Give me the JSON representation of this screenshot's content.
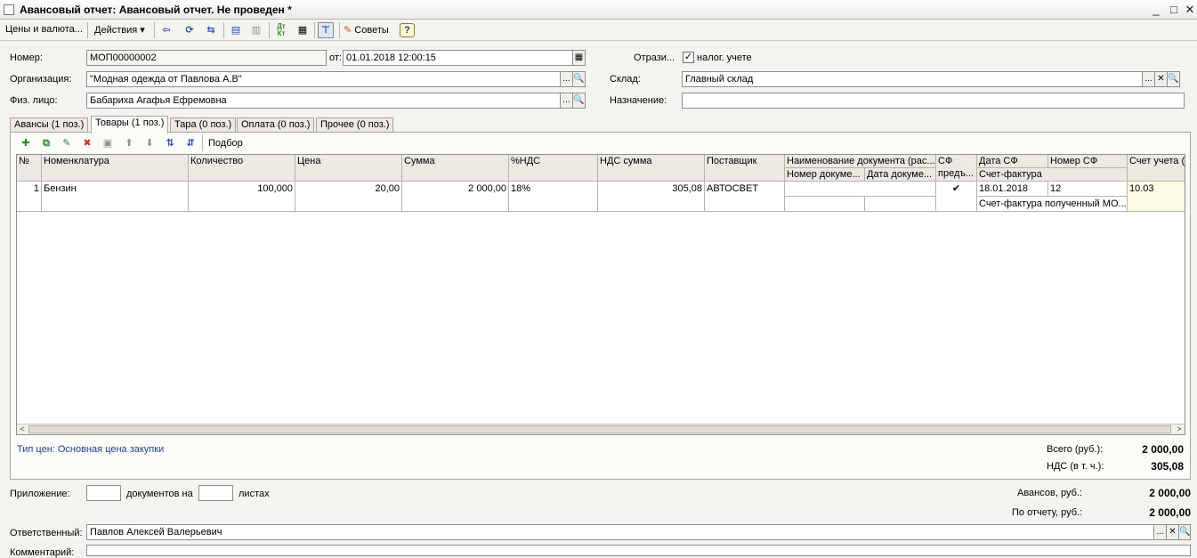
{
  "window": {
    "title": "Авансовый отчет: Авансовый отчет. Не проведен *",
    "buttons": {
      "minimize": "_",
      "maximize": "□",
      "close": "✕"
    }
  },
  "toolbar": {
    "prices_label": "Цены и валюта...",
    "actions_label": "Действия",
    "actions_arrow": "▾",
    "tips_label": "Советы",
    "help_label": "?"
  },
  "form": {
    "number_label": "Номер:",
    "number_value": "МОП00000002",
    "date_label": "от:",
    "date_value": "01.01.2018 12:00:15",
    "reflect_label": "Отрази...",
    "tax_accounting_label": "налог. учете",
    "tax_accounting_checked": "✓",
    "org_label": "Организация:",
    "org_value": "\"Модная одежда от Павлова А.В\"",
    "warehouse_label": "Склад:",
    "warehouse_value": "Главный склад",
    "person_label": "Физ. лицо:",
    "person_value": "Бабариха Агафья Ефремовна",
    "purpose_label": "Назначение:",
    "purpose_value": "",
    "select_btn": "...",
    "search_btn": "🔍",
    "clear_btn": "✕",
    "calendar_btn": "▦"
  },
  "tabs": [
    {
      "label": "Авансы (1 поз.)"
    },
    {
      "label": "Товары (1 поз.)"
    },
    {
      "label": "Тара (0 поз.)"
    },
    {
      "label": "Оплата (0 поз.)"
    },
    {
      "label": "Прочее (0 поз.)"
    }
  ],
  "grid_toolbar": {
    "selection_label": "Подбор"
  },
  "table": {
    "headers": {
      "num": "№",
      "nomenclature": "Номенклатура",
      "quantity": "Количество",
      "price": "Цена",
      "sum": "Сумма",
      "vat_rate": "%НДС",
      "vat_sum": "НДС сумма",
      "supplier": "Поставщик",
      "doc_name": "Наименование документа (рас...",
      "doc_number": "Номер докуме...",
      "doc_date": "Дата докуме...",
      "sf_top": "СФ",
      "sf_bottom": "предъ...",
      "sf_date": "Дата СФ",
      "sf_number": "Номер СФ",
      "sf_type": "Счет-фактура",
      "account": "Счет учета (Б"
    },
    "rows": [
      {
        "num": "1",
        "nomenclature": "Бензин",
        "quantity": "100,000",
        "price": "20,00",
        "sum": "2 000,00",
        "vat_rate": "18%",
        "vat_sum": "305,08",
        "supplier": "АВТОСВЕТ",
        "doc_name": "",
        "doc_number": "",
        "doc_date": "",
        "sf_presented": "✔",
        "sf_date": "18.01.2018",
        "sf_number": "12",
        "sf_type": "Счет-фактура полученный МО...",
        "account": "10.03"
      }
    ]
  },
  "scroll": {
    "left": "<",
    "right": ">"
  },
  "footer_panel": {
    "price_type": "Тип цен: Основная цена закупки",
    "total_label": "Всего (руб.):",
    "total_value": "2 000,00",
    "vat_label": "НДС (в т. ч.):",
    "vat_value": "305,08"
  },
  "bottom": {
    "attachment_label": "Приложение:",
    "attachment_docs": "",
    "docs_on_label": "документов на",
    "attachment_sheets": "",
    "sheets_label": "листах",
    "advances_label": "Авансов, руб.:",
    "advances_value": "2 000,00",
    "by_report_label": "По отчету, руб.:",
    "by_report_value": "2 000,00",
    "responsible_label": "Ответственный:",
    "responsible_value": "Павлов Алексей Валерьевич",
    "comment_label": "Комментарий:",
    "comment_value": ""
  }
}
